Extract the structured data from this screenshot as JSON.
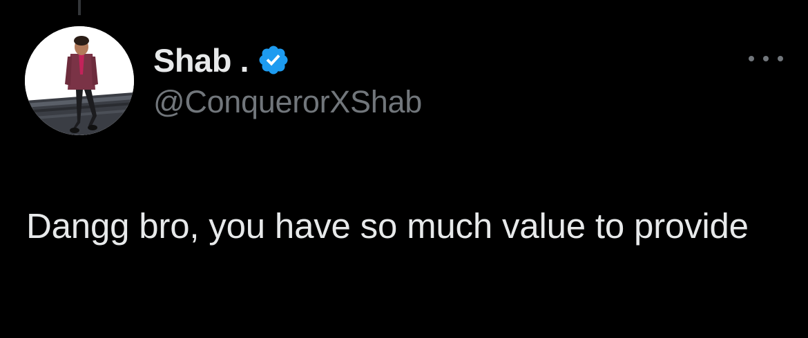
{
  "tweet": {
    "author": {
      "display_name": "Shab .",
      "handle": "@ConquerorXShab",
      "verified": true,
      "verified_icon": "verified-badge-icon",
      "avatar_icon": "user-avatar"
    },
    "text": "Dangg bro, you have so much value to provide",
    "more_icon": "more-options-icon"
  },
  "colors": {
    "background": "#000000",
    "primary_text": "#e7e9ea",
    "secondary_text": "#71767b",
    "verified_blue": "#1d9bf0"
  }
}
